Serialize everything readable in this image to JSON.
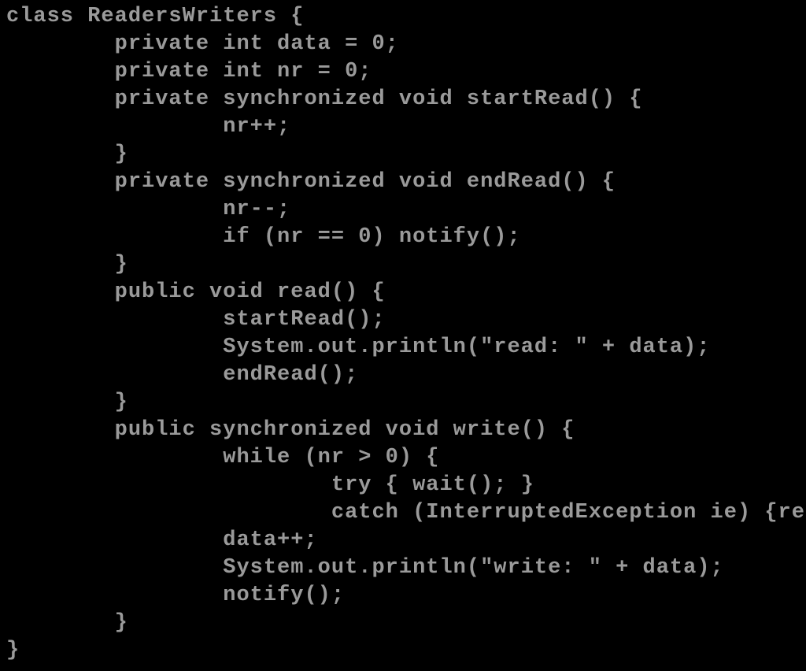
{
  "code": {
    "lines": [
      "class ReadersWriters {",
      "        private int data = 0;",
      "        private int nr = 0;",
      "        private synchronized void startRead() {",
      "                nr++;",
      "        }",
      "        private synchronized void endRead() {",
      "                nr--;",
      "                if (nr == 0) notify();",
      "        }",
      "        public void read() {",
      "                startRead();",
      "                System.out.println(\"read: \" + data);",
      "                endRead();",
      "        }",
      "        public synchronized void write() {",
      "                while (nr > 0) {",
      "                        try { wait(); }",
      "                        catch (InterruptedException ie) {return;}",
      "                data++;",
      "                System.out.println(\"write: \" + data);",
      "                notify();",
      "        }",
      "}"
    ]
  }
}
